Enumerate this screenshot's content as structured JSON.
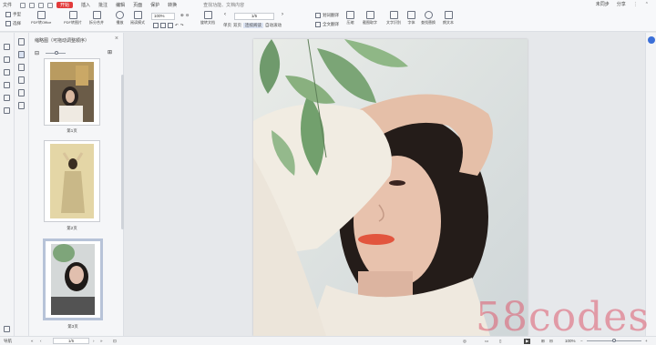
{
  "menubar": {
    "file_label": "文件",
    "tabs": [
      "开始",
      "插入",
      "批注",
      "编辑",
      "页面",
      "保护",
      "转换"
    ],
    "active_tab": "开始",
    "search_label": "查找功能、文档内容",
    "unsynced_label": "未同步",
    "share_label": "分享"
  },
  "toolbar": {
    "home_label": "手型",
    "select_label": "选择",
    "pdf_office_label": "PDF转Office",
    "pdf_image_label": "PDF转图片",
    "split_merge_label": "拆分合并",
    "play_label": "播放",
    "read_mode_label": "阅读模式",
    "zoom_value": "100%",
    "rotate_label": "旋转文档",
    "single_page_label": "单页",
    "double_page_label": "双页",
    "continuous_label": "连续阅读",
    "auto_scroll_label": "自动滚动",
    "page_value": "1/5",
    "translate_label": "划词翻译",
    "full_translate_label": "全文翻译",
    "compress_label": "压缩",
    "screenshot_label": "截图取字",
    "ocr_label": "文字识别",
    "font_label": "字体",
    "search_label": "查找替换",
    "read_aloud_label": "朗文本"
  },
  "thumbnail_panel": {
    "title": "缩略图（可拖动调整顺序）",
    "pages": [
      {
        "label": "第1页"
      },
      {
        "label": "第2页"
      },
      {
        "label": "第3页"
      }
    ]
  },
  "statusbar": {
    "nav_label": "导航",
    "page_value": "1/5",
    "zoom_value": "100%"
  },
  "watermark": "58codes",
  "colors": {
    "accent": "#e23b3b",
    "selection": "#b7c3d8",
    "panel_bg": "#f5f6f8"
  }
}
